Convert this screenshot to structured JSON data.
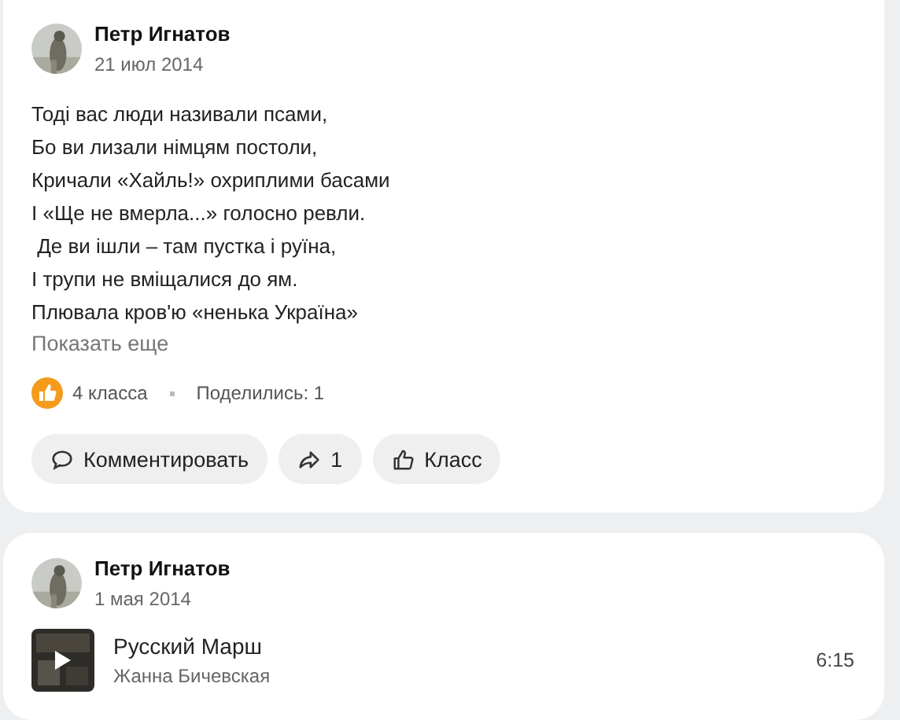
{
  "posts": [
    {
      "author": "Петр Игнатов",
      "date": "21 июл 2014",
      "kind": "text",
      "lines": [
        "Тоді вас люди називали псами,",
        "Бо ви лизали німцям постоли,",
        "Кричали «Хайль!» охриплими басами",
        "І «Ще не вмерла...» голосно ревли.",
        " Де ви ішли – там пустка і руїна,",
        "І трупи не вміщалися до ям.",
        "Плювала кров'ю «ненька Україна»"
      ],
      "show_more": "Показать еще",
      "likes": "4 класса",
      "shares": "Поделились: 1",
      "actions": [
        {
          "kind": "comment",
          "label": "Комментировать"
        },
        {
          "kind": "share",
          "label": "1"
        },
        {
          "kind": "like",
          "label": "Класс"
        }
      ]
    },
    {
      "author": "Петр Игнатов",
      "date": "1 мая 2014",
      "kind": "music",
      "track": {
        "title": "Русский Марш",
        "artist": "Жанна Бичевская",
        "duration": "6:15"
      }
    }
  ]
}
